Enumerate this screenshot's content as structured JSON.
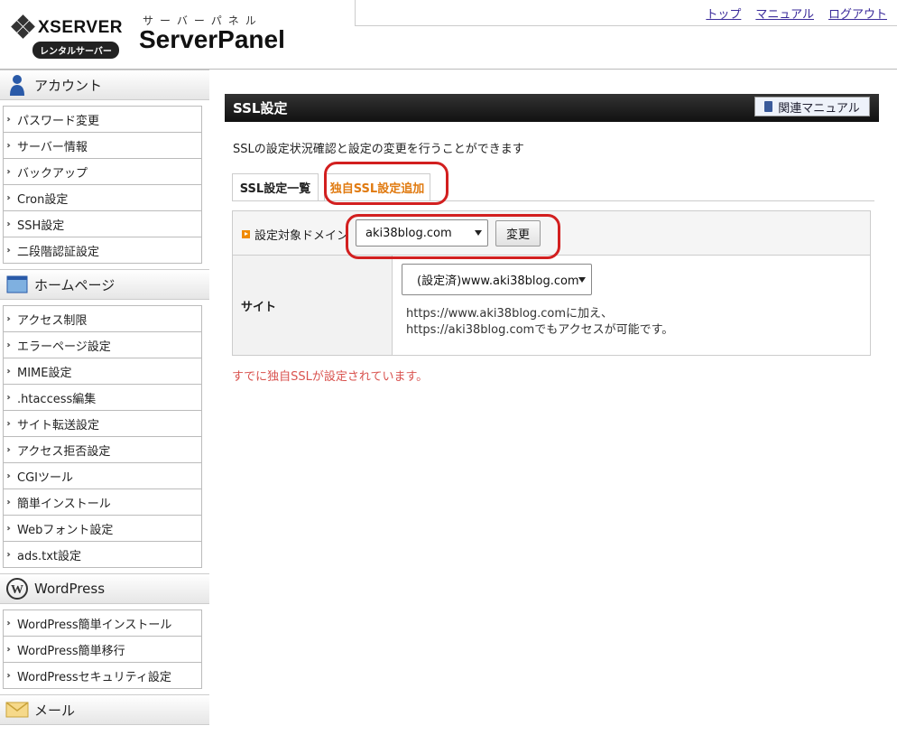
{
  "header": {
    "brand": "XSERVER",
    "brand_sub": "レンタルサーバー",
    "panel_kana": "サーバーパネル",
    "panel_name": "ServerPanel",
    "links": [
      "トップ",
      "マニュアル",
      "ログアウト"
    ]
  },
  "sidebar": {
    "sections": [
      {
        "title": "アカウント",
        "icon": "person-icon",
        "items": [
          "パスワード変更",
          "サーバー情報",
          "バックアップ",
          "Cron設定",
          "SSH設定",
          "二段階認証設定"
        ]
      },
      {
        "title": "ホームページ",
        "icon": "window-icon",
        "items": [
          "アクセス制限",
          "エラーページ設定",
          "MIME設定",
          ".htaccess編集",
          "サイト転送設定",
          "アクセス拒否設定",
          "CGIツール",
          "簡単インストール",
          "Webフォント設定",
          "ads.txt設定"
        ]
      },
      {
        "title": "WordPress",
        "icon": "wordpress-icon",
        "items": [
          "WordPress簡単インストール",
          "WordPress簡単移行",
          "WordPressセキュリティ設定"
        ]
      },
      {
        "title": "メール",
        "icon": "envelope-icon",
        "items": []
      }
    ]
  },
  "main": {
    "title": "SSL設定",
    "manual_button": "関連マニュアル",
    "description": "SSLの設定状況確認と設定の変更を行うことができます",
    "tabs": [
      "SSL設定一覧",
      "独自SSL設定追加"
    ],
    "domain_label": "設定対象ドメイン",
    "domain_value": "aki38blog.com",
    "change_button": "変更",
    "site_label": "サイト",
    "site_value": "(設定済)www.aki38blog.com",
    "note_line1": "https://www.aki38blog.comに加え、",
    "note_line2": "https://aki38blog.comでもアクセスが可能です。",
    "warning": "すでに独自SSLが設定されています。"
  },
  "colors": {
    "accent_orange": "#e07a10",
    "annotation_red": "#d21f1f",
    "warning_red": "#d9534f",
    "link_purple": "#3a2a9a"
  }
}
